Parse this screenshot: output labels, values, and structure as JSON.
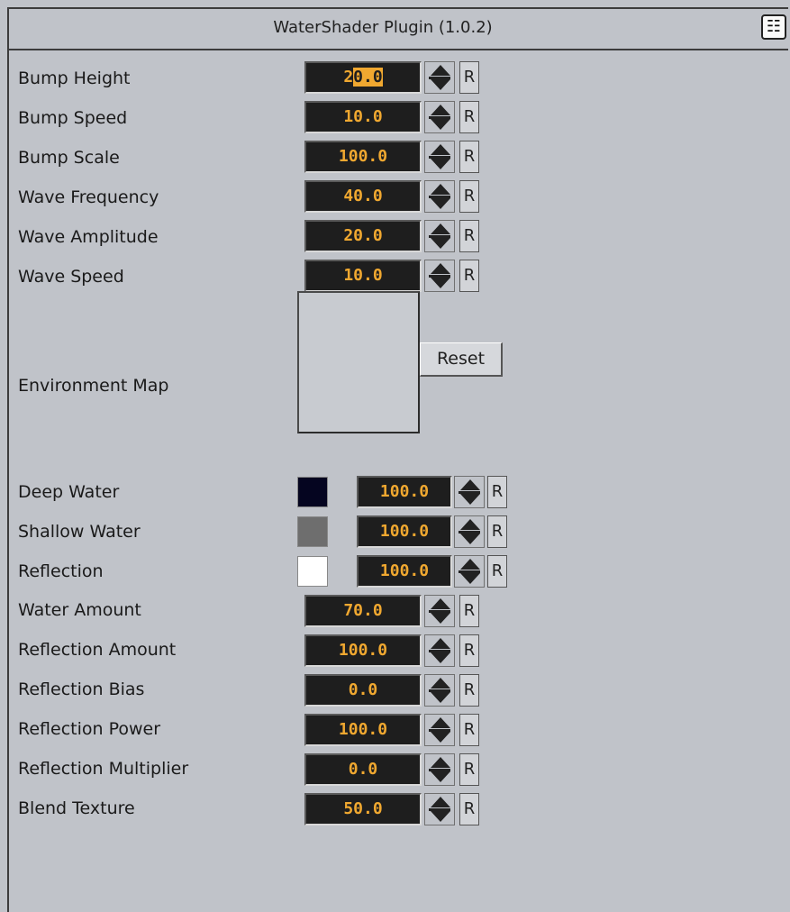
{
  "window": {
    "title": "WaterShader Plugin (1.0.2)"
  },
  "rows_top": [
    {
      "label": "Bump Height",
      "value": "20.0"
    },
    {
      "label": "Bump Speed",
      "value": "10.0"
    },
    {
      "label": "Bump Scale",
      "value": "100.0"
    },
    {
      "label": "Wave Frequency",
      "value": "40.0"
    },
    {
      "label": "Wave Amplitude",
      "value": "20.0"
    },
    {
      "label": "Wave Speed",
      "value": "10.0"
    }
  ],
  "env_map": {
    "label": "Environment Map",
    "reset_label": "Reset"
  },
  "color_rows": [
    {
      "label": "Deep Water",
      "color": "#050520",
      "value": "100.0"
    },
    {
      "label": "Shallow Water",
      "color": "#6e6e6e",
      "value": "100.0"
    },
    {
      "label": "Reflection",
      "color": "#ffffff",
      "value": "100.0"
    }
  ],
  "rows_bottom": [
    {
      "label": "Water Amount",
      "value": "70.0"
    },
    {
      "label": "Reflection Amount",
      "value": "100.0"
    },
    {
      "label": "Reflection Bias",
      "value": "0.0"
    },
    {
      "label": "Reflection Power",
      "value": "100.0"
    },
    {
      "label": "Reflection Multiplier",
      "value": "0.0"
    },
    {
      "label": "Blend Texture",
      "value": "50.0"
    }
  ],
  "reset_button_label": "R",
  "first_value_selected_part": "0.0",
  "first_value_prefix": "2"
}
